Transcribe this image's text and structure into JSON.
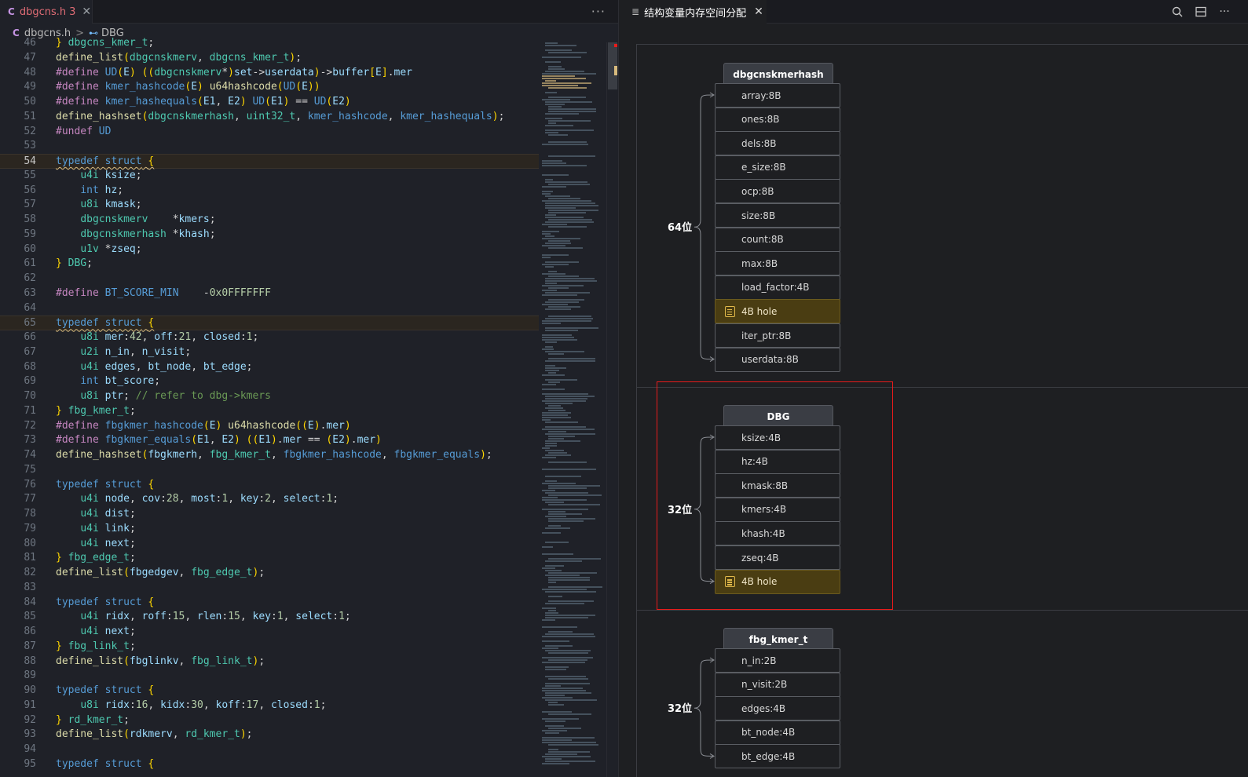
{
  "editor": {
    "tab": {
      "icon_letter": "C",
      "label": "dbgcns.h",
      "badge": "3",
      "close": "✕"
    },
    "more": "···",
    "breadcrumb": {
      "icon_letter": "C",
      "file": "dbgcns.h",
      "sep": ">",
      "symbol": "DBG"
    },
    "lines": [
      {
        "n": "46",
        "t": "} dbgcns_kmer_t;"
      },
      {
        "n": "47",
        "t": "define_list(dbgcnskmerv, dbgcns_kmer_t);"
      },
      {
        "n": "48",
        "t": "#define UD(E) ((dbgcnskmerv*)set->userdata)->buffer[E].mer"
      },
      {
        "n": "49",
        "t": "#define kmer_hashcode(E) u64hashcode(UD(E))"
      },
      {
        "n": "50",
        "t": "#define kmer_hashequals(E1, E2) UD(E1) == UD(E2)"
      },
      {
        "n": "51",
        "t": "define_hashset(dbgcnskmerhash, uint32_t, kmer_hashcode, kmer_hashequals);"
      },
      {
        "n": "52",
        "t": "#undef UD"
      },
      {
        "n": "53",
        "t": ""
      },
      {
        "n": "54",
        "t": "typedef struct {"
      },
      {
        "n": "55",
        "t": "    u4i ksize;"
      },
      {
        "n": "56",
        "t": "    int hz;"
      },
      {
        "n": "57",
        "t": "    u8i kmask;"
      },
      {
        "n": "58",
        "t": "    dbgcnskmerv    *kmers;"
      },
      {
        "n": "59",
        "t": "    dbgcnskmerhash *khash;"
      },
      {
        "n": "60",
        "t": "    u1v *zseq;"
      },
      {
        "n": "61",
        "t": "} DBG;"
      },
      {
        "n": "62",
        "t": ""
      },
      {
        "n": "63",
        "t": "#define BT_SCORE_MIN    -0x0FFFFFFF"
      },
      {
        "n": "64",
        "t": ""
      },
      {
        "n": "65",
        "t": "typedef struct {"
      },
      {
        "n": "66",
        "t": "    u8i mer:42, off:21, closed:1;"
      },
      {
        "n": "67",
        "t": "    u2i n_in, n_visit;"
      },
      {
        "n": "68",
        "t": "    u4i edges, bt_node, bt_edge;"
      },
      {
        "n": "69",
        "t": "    int bt_score;"
      },
      {
        "n": "70",
        "t": "    u8i ptr; // refer to dbg->kmers"
      },
      {
        "n": "71",
        "t": "} fbg_kmer_t;"
      },
      {
        "n": "72",
        "t": "#define fbgkmer_hashcode(E) u64hashcode((E).mer)"
      },
      {
        "n": "73",
        "t": "#define fbgkmer_equals(E1, E2) ((E1).mer == (E2).mer)"
      },
      {
        "n": "74",
        "t": "define_hashset(fbgkmerh, fbg_kmer_t, fbgkmer_hashcode, fbgkmer_equals);"
      },
      {
        "n": "75",
        "t": ""
      },
      {
        "n": "76",
        "t": "typedef struct {"
      },
      {
        "n": "77",
        "t": "    u4i node, cov:28, most:1, key:2, select:1;"
      },
      {
        "n": "78",
        "t": "    u4i dist;"
      },
      {
        "n": "79",
        "t": "    u4i link;"
      },
      {
        "n": "80",
        "t": "    u4i next;"
      },
      {
        "n": "81",
        "t": "} fbg_edge_t;"
      },
      {
        "n": "82",
        "t": "define_list(fbgedgev, fbg_edge_t);"
      },
      {
        "n": "83",
        "t": ""
      },
      {
        "n": "84",
        "t": "typedef struct {"
      },
      {
        "n": "85",
        "t": "    u4i ridx, roff:15, rlen:15, key:1, select:1;"
      },
      {
        "n": "86",
        "t": "    u4i next;"
      },
      {
        "n": "87",
        "t": "} fbg_link_t;"
      },
      {
        "n": "88",
        "t": "define_list(fbglinkv, fbg_link_t);"
      },
      {
        "n": "89",
        "t": ""
      },
      {
        "n": "90",
        "t": "typedef struct {"
      },
      {
        "n": "91",
        "t": "    u8i ridx:16, kidx:30, koff:17, closed:1;"
      },
      {
        "n": "92",
        "t": "} rd_kmer_t;"
      },
      {
        "n": "93",
        "t": "define_list(rdkmerv, rd_kmer_t);"
      },
      {
        "n": "94",
        "t": ""
      },
      {
        "n": "95",
        "t": "typedef struct {"
      }
    ],
    "active_line": "54"
  },
  "panel": {
    "tab": {
      "label": "结构变量内存空间分配",
      "close": "✕"
    },
    "structs": [
      {
        "title": "dbgcnskmerhash",
        "bits": "64位",
        "fields": [
          "array:8B",
          "ones:8B",
          "dels:8B",
          "e_size:8B",
          "ocp:8B",
          "size:8B",
          "count:8B",
          "max:8B",
          "load_factor:4B",
          "4B hole",
          "iter_ptr:8B",
          "userdata:8B"
        ],
        "hole_index": 9
      },
      {
        "title": "DBG",
        "bits": "32位",
        "fields": [
          "ksize:4B",
          "hz:4B",
          "kmask:8B",
          "kmers:4B",
          "khash:4B",
          "zseq:4B",
          "4B hole"
        ],
        "hole_index": 6
      },
      {
        "title": "fbg_kmer_t",
        "bits": "32位",
        "fields": [
          "n_in:2B",
          "n_visit:2B",
          "edges:4B",
          "bt_node:4B",
          "bt_edge:4B"
        ],
        "hole_index": -1
      }
    ]
  },
  "colors": {
    "accent_red": "#e81b1b",
    "hole_fill": "#4a3d12",
    "node_title_fill": "#3a3d44"
  }
}
